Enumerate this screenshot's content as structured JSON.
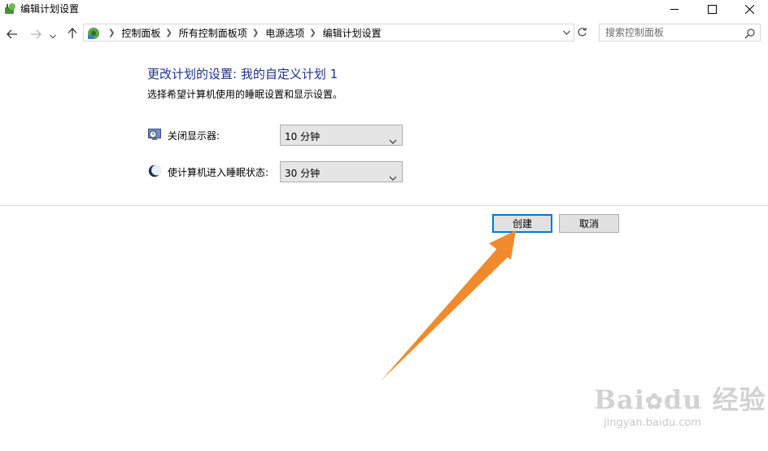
{
  "window": {
    "title": "编辑计划设置",
    "app_icon": "power-options-icon",
    "controls": [
      "minimize-icon",
      "maximize-icon",
      "close-icon"
    ]
  },
  "navigation": {
    "back_icon": "back-arrow-icon",
    "forward_icon": "forward-arrow-icon",
    "recent_icon": "chevron-down-icon",
    "up_icon": "up-arrow-icon",
    "breadcrumbs": [
      "控制面板",
      "所有控制面板项",
      "电源选项",
      "编辑计划设置"
    ],
    "refresh_icon": "refresh-icon",
    "search_placeholder": "搜索控制面板"
  },
  "content": {
    "heading": "更改计划的设置: 我的自定义计划 1",
    "subtext": "选择希望计算机使用的睡眠设置和显示设置。",
    "settings": [
      {
        "label": "关闭显示器:",
        "value": "10 分钟",
        "icon": "display-icon"
      },
      {
        "label": "使计算机进入睡眠状态:",
        "value": "30 分钟",
        "icon": "sleep-moon-icon"
      }
    ]
  },
  "buttons": {
    "create": "创建",
    "cancel": "取消"
  },
  "watermark": {
    "logo": "Bai du 经验",
    "url": "jingyan.baidu.com"
  },
  "colors": {
    "heading": "#1e3287",
    "primary_border": "#0078d7",
    "annotation_arrow": "#f08a2c"
  }
}
